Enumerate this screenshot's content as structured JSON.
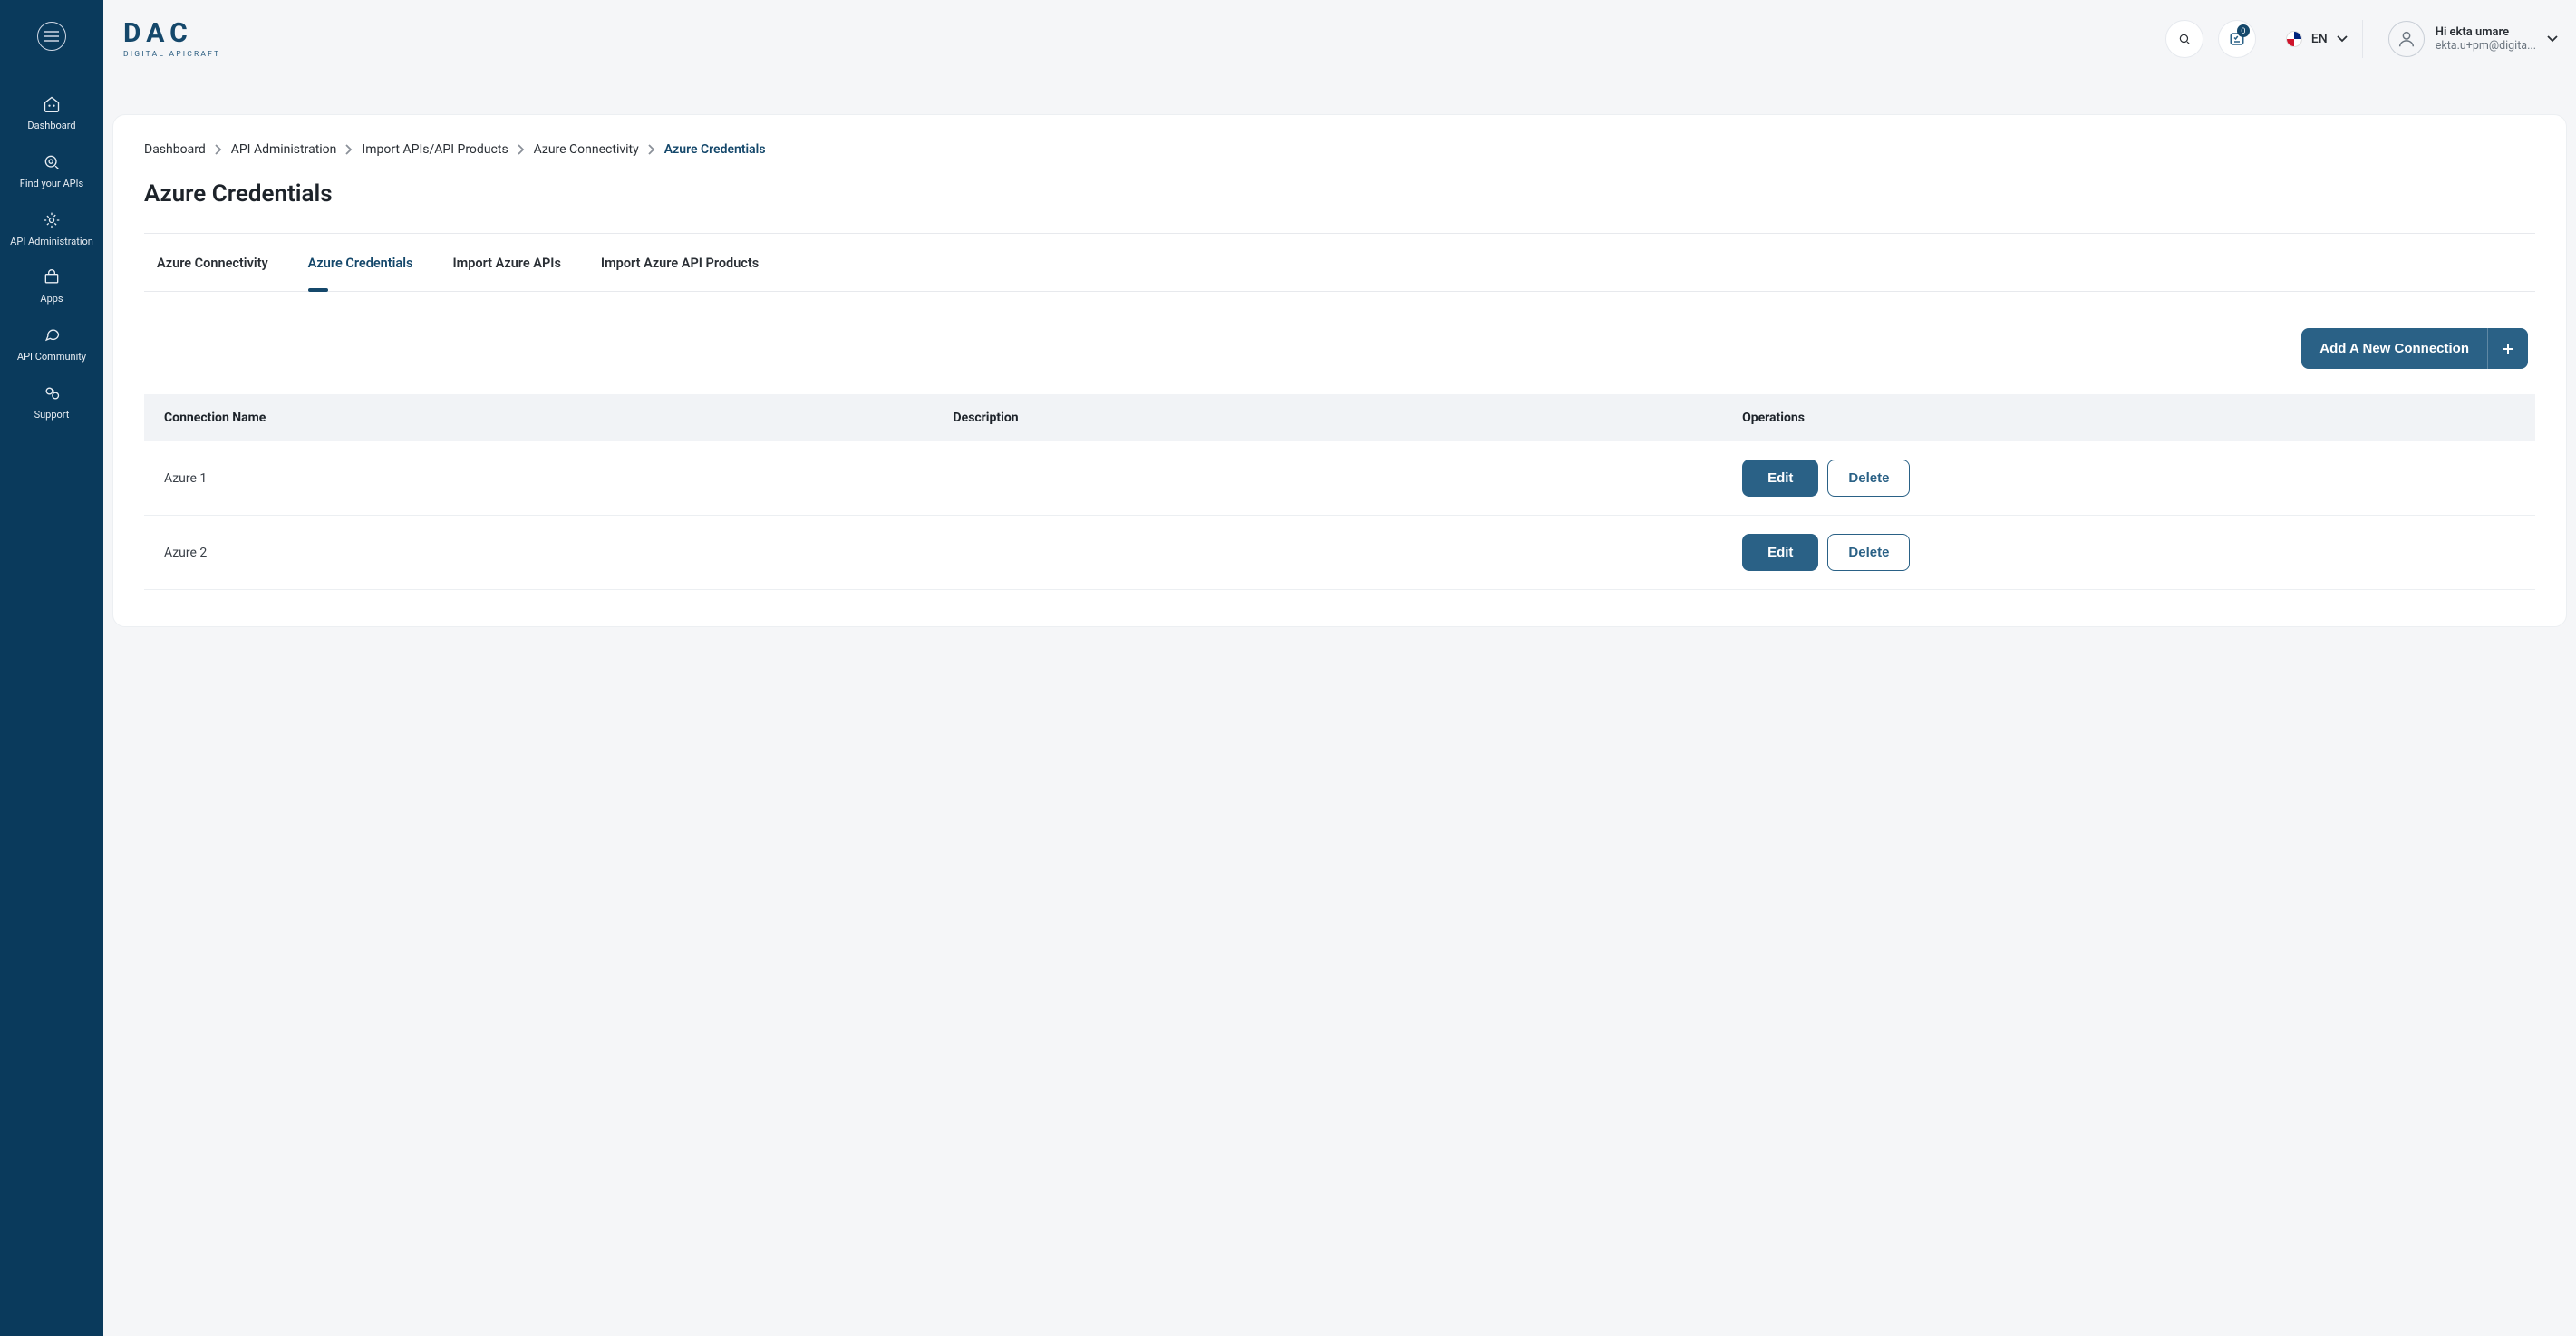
{
  "brand": {
    "logo_text": "DAC",
    "tagline": "DIGITAL APICRAFT"
  },
  "sidebar": {
    "items": [
      {
        "label": "Dashboard"
      },
      {
        "label": "Find your APIs"
      },
      {
        "label": "API Administration"
      },
      {
        "label": "Apps"
      },
      {
        "label": "API Community"
      },
      {
        "label": "Support"
      }
    ]
  },
  "header": {
    "notifications_badge": "0",
    "language_code": "EN",
    "user": {
      "greeting": "Hi ekta umare",
      "email": "ekta.u+pm@digita..."
    }
  },
  "breadcrumb": [
    "Dashboard",
    "API Administration",
    "Import APIs/API Products",
    "Azure Connectivity",
    "Azure Credentials"
  ],
  "page_title": "Azure Credentials",
  "tabs": [
    {
      "label": "Azure Connectivity",
      "active": false
    },
    {
      "label": "Azure Credentials",
      "active": true
    },
    {
      "label": "Import Azure APIs",
      "active": false
    },
    {
      "label": "Import Azure API Products",
      "active": false
    }
  ],
  "buttons": {
    "add_connection": "Add A New Connection",
    "edit": "Edit",
    "delete": "Delete"
  },
  "table": {
    "headers": {
      "name": "Connection Name",
      "description": "Description",
      "operations": "Operations"
    },
    "rows": [
      {
        "name": "Azure 1",
        "description": ""
      },
      {
        "name": "Azure 2",
        "description": ""
      }
    ]
  }
}
